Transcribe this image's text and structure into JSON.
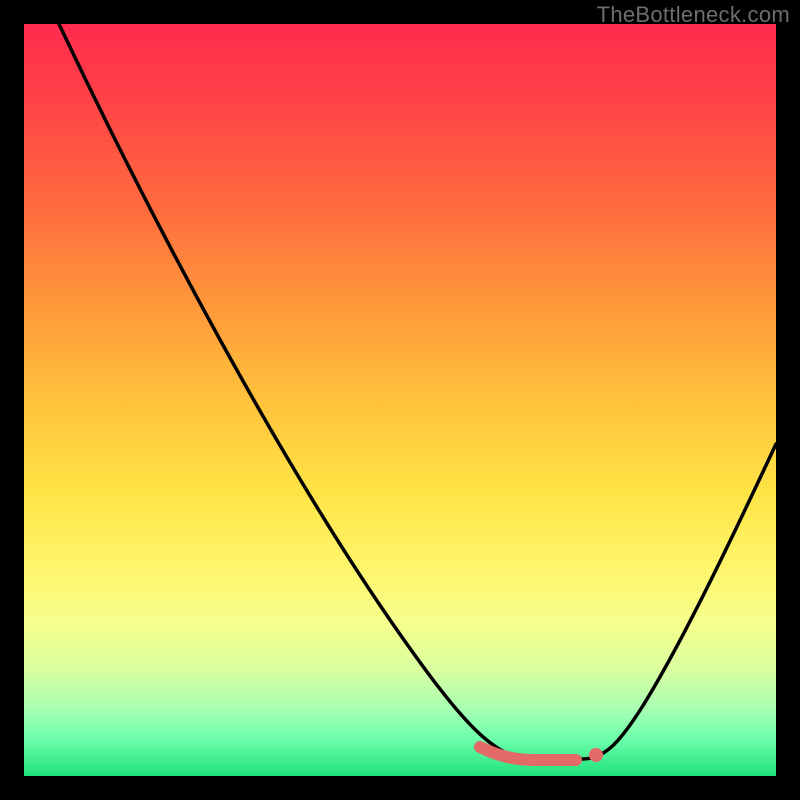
{
  "watermark": "TheBottleneck.com",
  "chart_data": {
    "type": "line",
    "title": "",
    "xlabel": "",
    "ylabel": "",
    "xlim": [
      0,
      100
    ],
    "ylim": [
      0,
      100
    ],
    "x": [
      0,
      5,
      10,
      15,
      20,
      25,
      30,
      35,
      40,
      45,
      50,
      55,
      60,
      65,
      70,
      72,
      75,
      80,
      85,
      90,
      95,
      100
    ],
    "values": [
      100,
      94,
      88,
      81,
      74,
      67,
      59,
      52,
      44,
      36,
      28,
      21,
      14,
      8,
      3,
      1,
      0,
      4,
      12,
      22,
      34,
      48
    ],
    "annotations": {
      "highlight_range_x": [
        60,
        70
      ],
      "highlight_color": "#e36a66",
      "highlight_end_dot_x": 70
    }
  }
}
